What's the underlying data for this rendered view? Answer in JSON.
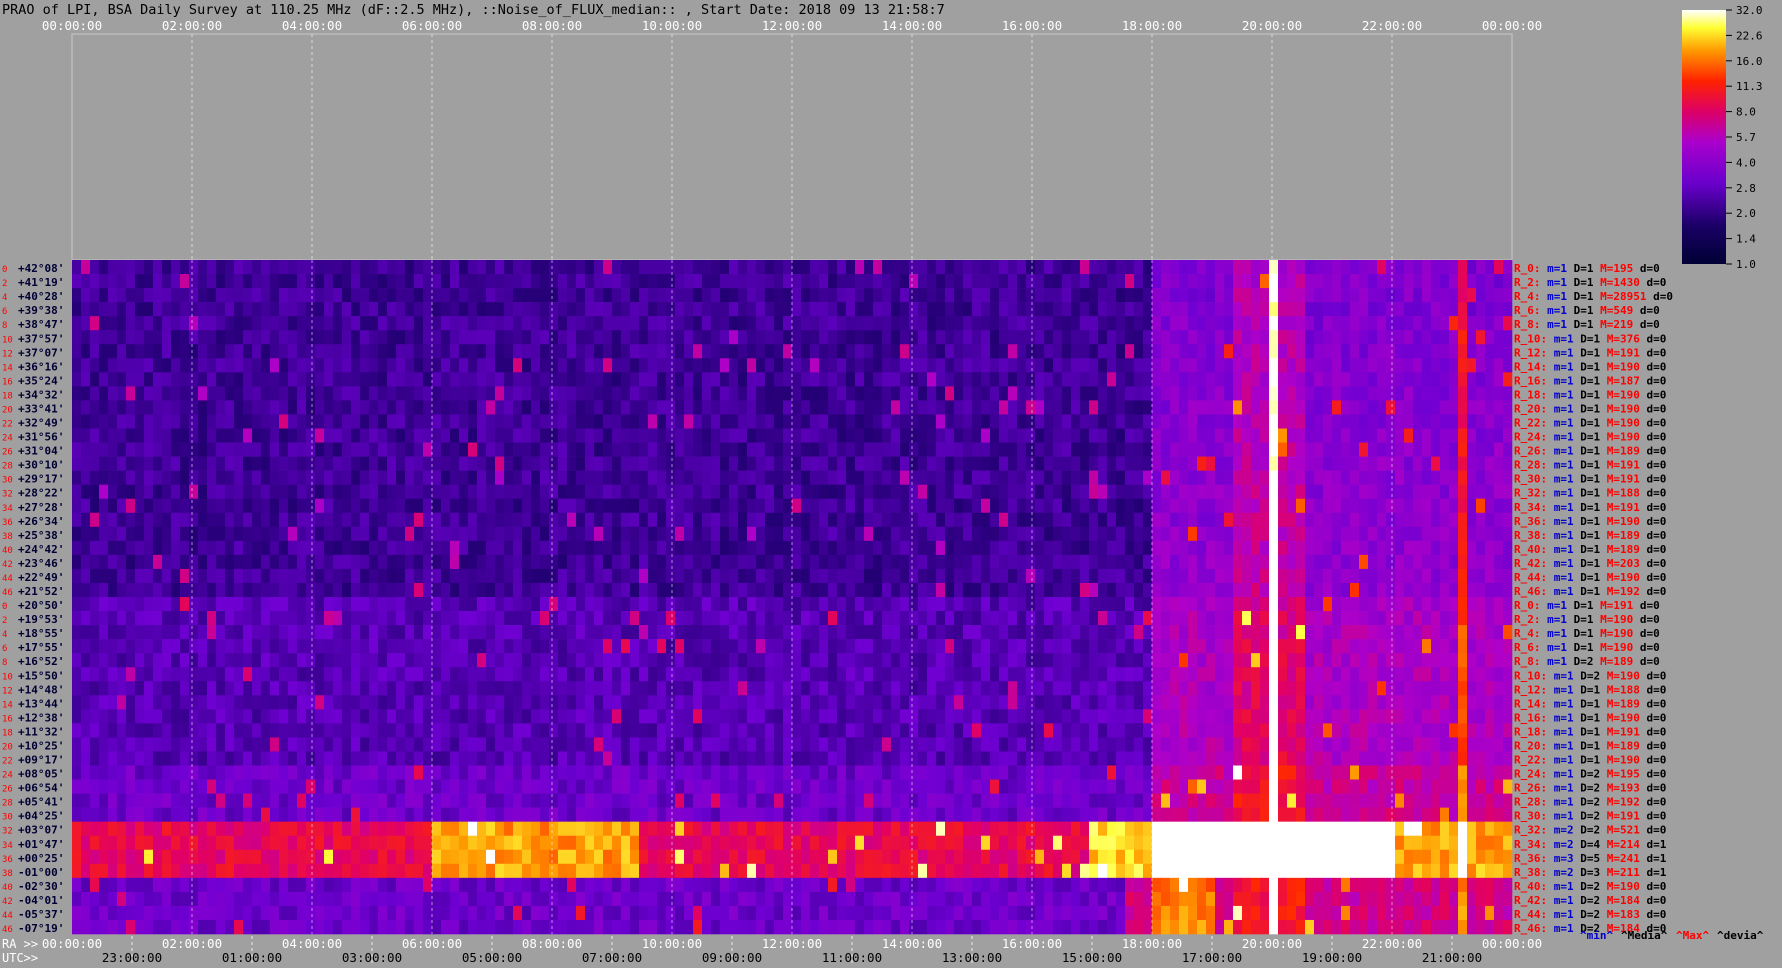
{
  "header": {
    "title": "PRAO of LPI, BSA Daily Survey at 110.25 MHz (dF::2.5 MHz), ::Noise_of_FLUX_median:: , Start Date: 2018 09 13 21:58:7"
  },
  "colors": {
    "background": "#a0a0a0",
    "label_red": "#ff0000",
    "label_blue": "#0000cc",
    "text": "#000000",
    "heat_low": "#000033",
    "heat_mid": "#8800ff",
    "heat_high": "#ffffff"
  },
  "chart_data": {
    "type": "heatmap",
    "title": "PRAO of LPI, BSA Daily Survey at 110.25 MHz (dF::2.5 MHz), ::Noise_of_FLUX_median:: , Start Date: 2018 09 13 21:58:7",
    "xlabel_ra": "RA >>",
    "xlabel_utc": "UTC>>",
    "ra_ticks": [
      "00:00:00",
      "02:00:00",
      "04:00:00",
      "06:00:00",
      "08:00:00",
      "10:00:00",
      "12:00:00",
      "14:00:00",
      "16:00:00",
      "18:00:00",
      "20:00:00",
      "22:00:00",
      "00:00:00"
    ],
    "utc_ticks": [
      "23:00:00",
      "01:00:00",
      "03:00:00",
      "05:00:00",
      "07:00:00",
      "09:00:00",
      "11:00:00",
      "13:00:00",
      "15:00:00",
      "17:00:00",
      "19:00:00",
      "21:00:00"
    ],
    "declinations": [
      "+42°08'",
      "+41°19'",
      "+40°28'",
      "+39°38'",
      "+38°47'",
      "+37°57'",
      "+37°07'",
      "+36°16'",
      "+35°24'",
      "+34°32'",
      "+33°41'",
      "+32°49'",
      "+31°56'",
      "+31°04'",
      "+30°10'",
      "+29°17'",
      "+28°22'",
      "+27°28'",
      "+26°34'",
      "+25°38'",
      "+24°42'",
      "+23°46'",
      "+22°49'",
      "+21°52'",
      "+20°50'",
      "+19°53'",
      "+18°55'",
      "+17°55'",
      "+16°52'",
      "+15°50'",
      "+14°48'",
      "+13°44'",
      "+12°38'",
      "+11°32'",
      "+10°25'",
      "+09°17'",
      "+08°05'",
      "+06°54'",
      "+05°41'",
      "+04°25'",
      "+03°07'",
      "+01°47'",
      "+00°25'",
      "-01°00'",
      "-02°30'",
      "-04°01'",
      "-05°37'",
      "-07°19'"
    ],
    "beam_numbers": [
      "0",
      "2",
      "4",
      "6",
      "8",
      "10",
      "12",
      "14",
      "16",
      "18",
      "20",
      "22",
      "24",
      "26",
      "28",
      "30",
      "32",
      "34",
      "36",
      "38",
      "40",
      "42",
      "44",
      "46",
      "0",
      "2",
      "4",
      "6",
      "8",
      "10",
      "12",
      "14",
      "16",
      "18",
      "20",
      "22",
      "24",
      "26",
      "28",
      "30",
      "32",
      "34",
      "36",
      "38",
      "40",
      "42",
      "44",
      "46"
    ],
    "colorbar": {
      "ticks": [
        "32.0",
        "22.6",
        "16.0",
        "11.3",
        "8.0",
        "5.7",
        "4.0",
        "2.8",
        "2.0",
        "1.4",
        "1.0"
      ],
      "range": [
        1.0,
        32.0
      ],
      "scale": "log"
    },
    "row_stats": [
      {
        "r": "R_0:",
        "m": "1",
        "D": "1",
        "M": "195",
        "d": "0"
      },
      {
        "r": "R_2:",
        "m": "1",
        "D": "1",
        "M": "1430",
        "d": "0"
      },
      {
        "r": "R_4:",
        "m": "1",
        "D": "1",
        "M": "28951",
        "d": "0"
      },
      {
        "r": "R_6:",
        "m": "1",
        "D": "1",
        "M": "549",
        "d": "0"
      },
      {
        "r": "R_8:",
        "m": "1",
        "D": "1",
        "M": "219",
        "d": "0"
      },
      {
        "r": "R_10:",
        "m": "1",
        "D": "1",
        "M": "376",
        "d": "0"
      },
      {
        "r": "R_12:",
        "m": "1",
        "D": "1",
        "M": "191",
        "d": "0"
      },
      {
        "r": "R_14:",
        "m": "1",
        "D": "1",
        "M": "190",
        "d": "0"
      },
      {
        "r": "R_16:",
        "m": "1",
        "D": "1",
        "M": "187",
        "d": "0"
      },
      {
        "r": "R_18:",
        "m": "1",
        "D": "1",
        "M": "190",
        "d": "0"
      },
      {
        "r": "R_20:",
        "m": "1",
        "D": "1",
        "M": "190",
        "d": "0"
      },
      {
        "r": "R_22:",
        "m": "1",
        "D": "1",
        "M": "190",
        "d": "0"
      },
      {
        "r": "R_24:",
        "m": "1",
        "D": "1",
        "M": "190",
        "d": "0"
      },
      {
        "r": "R_26:",
        "m": "1",
        "D": "1",
        "M": "189",
        "d": "0"
      },
      {
        "r": "R_28:",
        "m": "1",
        "D": "1",
        "M": "191",
        "d": "0"
      },
      {
        "r": "R_30:",
        "m": "1",
        "D": "1",
        "M": "191",
        "d": "0"
      },
      {
        "r": "R_32:",
        "m": "1",
        "D": "1",
        "M": "188",
        "d": "0"
      },
      {
        "r": "R_34:",
        "m": "1",
        "D": "1",
        "M": "191",
        "d": "0"
      },
      {
        "r": "R_36:",
        "m": "1",
        "D": "1",
        "M": "190",
        "d": "0"
      },
      {
        "r": "R_38:",
        "m": "1",
        "D": "1",
        "M": "189",
        "d": "0"
      },
      {
        "r": "R_40:",
        "m": "1",
        "D": "1",
        "M": "189",
        "d": "0"
      },
      {
        "r": "R_42:",
        "m": "1",
        "D": "1",
        "M": "203",
        "d": "0"
      },
      {
        "r": "R_44:",
        "m": "1",
        "D": "1",
        "M": "190",
        "d": "0"
      },
      {
        "r": "R_46:",
        "m": "1",
        "D": "1",
        "M": "192",
        "d": "0"
      },
      {
        "r": "R_0:",
        "m": "1",
        "D": "1",
        "M": "191",
        "d": "0"
      },
      {
        "r": "R_2:",
        "m": "1",
        "D": "1",
        "M": "190",
        "d": "0"
      },
      {
        "r": "R_4:",
        "m": "1",
        "D": "1",
        "M": "190",
        "d": "0"
      },
      {
        "r": "R_6:",
        "m": "1",
        "D": "1",
        "M": "190",
        "d": "0"
      },
      {
        "r": "R_8:",
        "m": "1",
        "D": "2",
        "M": "189",
        "d": "0"
      },
      {
        "r": "R_10:",
        "m": "1",
        "D": "2",
        "M": "190",
        "d": "0"
      },
      {
        "r": "R_12:",
        "m": "1",
        "D": "1",
        "M": "188",
        "d": "0"
      },
      {
        "r": "R_14:",
        "m": "1",
        "D": "1",
        "M": "189",
        "d": "0"
      },
      {
        "r": "R_16:",
        "m": "1",
        "D": "1",
        "M": "190",
        "d": "0"
      },
      {
        "r": "R_18:",
        "m": "1",
        "D": "1",
        "M": "191",
        "d": "0"
      },
      {
        "r": "R_20:",
        "m": "1",
        "D": "1",
        "M": "189",
        "d": "0"
      },
      {
        "r": "R_22:",
        "m": "1",
        "D": "1",
        "M": "190",
        "d": "0"
      },
      {
        "r": "R_24:",
        "m": "1",
        "D": "2",
        "M": "195",
        "d": "0"
      },
      {
        "r": "R_26:",
        "m": "1",
        "D": "2",
        "M": "193",
        "d": "0"
      },
      {
        "r": "R_28:",
        "m": "1",
        "D": "2",
        "M": "192",
        "d": "0"
      },
      {
        "r": "R_30:",
        "m": "1",
        "D": "2",
        "M": "191",
        "d": "0"
      },
      {
        "r": "R_32:",
        "m": "2",
        "D": "2",
        "M": "521",
        "d": "0"
      },
      {
        "r": "R_34:",
        "m": "2",
        "D": "4",
        "M": "214",
        "d": "1"
      },
      {
        "r": "R_36:",
        "m": "3",
        "D": "5",
        "M": "241",
        "d": "1"
      },
      {
        "r": "R_38:",
        "m": "2",
        "D": "3",
        "M": "211",
        "d": "1"
      },
      {
        "r": "R_40:",
        "m": "1",
        "D": "2",
        "M": "190",
        "d": "0"
      },
      {
        "r": "R_42:",
        "m": "1",
        "D": "2",
        "M": "184",
        "d": "0"
      },
      {
        "r": "R_44:",
        "m": "1",
        "D": "2",
        "M": "183",
        "d": "0"
      },
      {
        "r": "R_46:",
        "m": "1",
        "D": "2",
        "M": "184",
        "d": "0"
      }
    ],
    "stat_keys": {
      "m": "m=",
      "D": "D=",
      "M": "M=",
      "d": "d="
    },
    "legend": [
      "^min^",
      "^Media^",
      "^Max^",
      "^devia^"
    ],
    "features": {
      "bright_band_rows": [
        40,
        41,
        42,
        43
      ],
      "strong_source_ra_h": 20.0,
      "vertical_source_ra_h": [
        20.0,
        23.2
      ],
      "diffuse_region_ra_h": [
        18.0,
        24.0
      ]
    }
  }
}
